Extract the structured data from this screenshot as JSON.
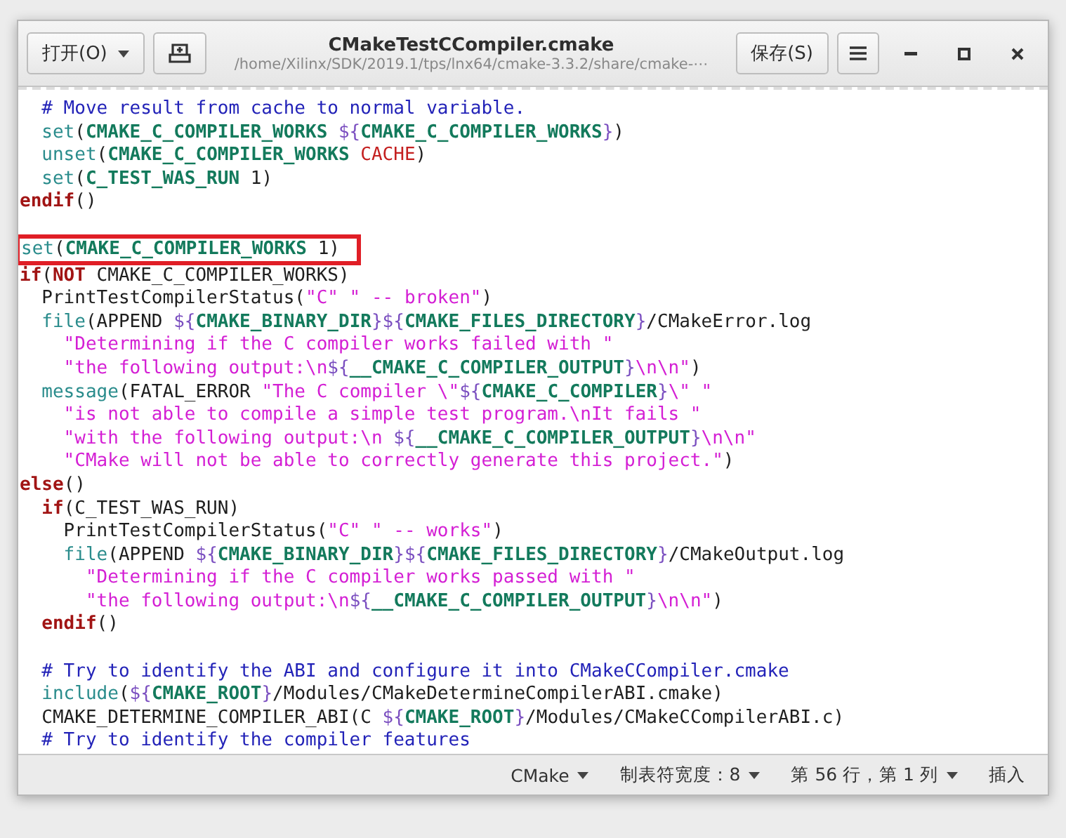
{
  "window": {
    "title": "CMakeTestCCompiler.cmake",
    "subtitle": "/home/Xilinx/SDK/2019.1/tps/lnx64/cmake-3.3.2/share/cmake-⋯"
  },
  "header": {
    "open_button": "打开(O)",
    "save_button": "保存(S)"
  },
  "editor": {
    "lines": [
      {
        "kind": "code",
        "segments": [
          {
            "kind": "comment",
            "text": "  # Move result from cache to normal variable."
          }
        ]
      },
      {
        "kind": "code",
        "segments": [
          {
            "kind": "command",
            "text": "  set"
          },
          {
            "kind": "plain",
            "text": "("
          },
          {
            "kind": "variable",
            "text": "CMAKE_C_COMPILER_WORKS"
          },
          {
            "kind": "brace",
            "text": " ${"
          },
          {
            "kind": "variable",
            "text": "CMAKE_C_COMPILER_WORKS"
          },
          {
            "kind": "brace",
            "text": "}"
          },
          {
            "kind": "plain",
            "text": ")"
          }
        ]
      },
      {
        "kind": "code",
        "segments": [
          {
            "kind": "command",
            "text": "  unset"
          },
          {
            "kind": "plain",
            "text": "("
          },
          {
            "kind": "variable",
            "text": "CMAKE_C_COMPILER_WORKS"
          },
          {
            "kind": "constant",
            "text": " CACHE"
          },
          {
            "kind": "plain",
            "text": ")"
          }
        ]
      },
      {
        "kind": "code",
        "segments": [
          {
            "kind": "command",
            "text": "  set"
          },
          {
            "kind": "plain",
            "text": "("
          },
          {
            "kind": "variable",
            "text": "C_TEST_WAS_RUN"
          },
          {
            "kind": "plain",
            "text": " 1)"
          }
        ]
      },
      {
        "kind": "code",
        "segments": [
          {
            "kind": "control",
            "text": "endif"
          },
          {
            "kind": "plain",
            "text": "()"
          }
        ]
      },
      {
        "kind": "blank"
      },
      {
        "kind": "code",
        "boxed": true,
        "segments": [
          {
            "kind": "command",
            "text": "set"
          },
          {
            "kind": "plain",
            "text": "("
          },
          {
            "kind": "variable",
            "text": "CMAKE_C_COMPILER_WORKS"
          },
          {
            "kind": "plain",
            "text": " 1)"
          }
        ]
      },
      {
        "kind": "code",
        "segments": [
          {
            "kind": "control",
            "text": "if"
          },
          {
            "kind": "plain",
            "text": "("
          },
          {
            "kind": "control",
            "text": "NOT"
          },
          {
            "kind": "plain",
            "text": " CMAKE_C_COMPILER_WORKS)"
          }
        ]
      },
      {
        "kind": "code",
        "segments": [
          {
            "kind": "plain",
            "text": "  PrintTestCompilerStatus("
          },
          {
            "kind": "string",
            "text": "\"C\" \" -- broken\""
          },
          {
            "kind": "plain",
            "text": ")"
          }
        ]
      },
      {
        "kind": "code",
        "segments": [
          {
            "kind": "command",
            "text": "  file"
          },
          {
            "kind": "plain",
            "text": "(APPEND "
          },
          {
            "kind": "brace",
            "text": "${"
          },
          {
            "kind": "variable",
            "text": "CMAKE_BINARY_DIR"
          },
          {
            "kind": "brace",
            "text": "}${"
          },
          {
            "kind": "variable",
            "text": "CMAKE_FILES_DIRECTORY"
          },
          {
            "kind": "brace",
            "text": "}"
          },
          {
            "kind": "plain",
            "text": "/CMakeError.log"
          }
        ]
      },
      {
        "kind": "code",
        "segments": [
          {
            "kind": "string",
            "text": "    \"Determining if the C compiler works failed with \""
          }
        ]
      },
      {
        "kind": "code",
        "segments": [
          {
            "kind": "string",
            "text": "    \"the following output:\\n"
          },
          {
            "kind": "brace",
            "text": "${"
          },
          {
            "kind": "variable",
            "text": "__CMAKE_C_COMPILER_OUTPUT"
          },
          {
            "kind": "brace",
            "text": "}"
          },
          {
            "kind": "string",
            "text": "\\n\\n\""
          },
          {
            "kind": "plain",
            "text": ")"
          }
        ]
      },
      {
        "kind": "code",
        "segments": [
          {
            "kind": "command",
            "text": "  message"
          },
          {
            "kind": "plain",
            "text": "(FATAL_ERROR "
          },
          {
            "kind": "string",
            "text": "\"The C compiler \\\""
          },
          {
            "kind": "brace",
            "text": "${"
          },
          {
            "kind": "variable",
            "text": "CMAKE_C_COMPILER"
          },
          {
            "kind": "brace",
            "text": "}"
          },
          {
            "kind": "string",
            "text": "\\\" \""
          }
        ]
      },
      {
        "kind": "code",
        "segments": [
          {
            "kind": "string",
            "text": "    \"is not able to compile a simple test program.\\nIt fails \""
          }
        ]
      },
      {
        "kind": "code",
        "segments": [
          {
            "kind": "string",
            "text": "    \"with the following output:\\n "
          },
          {
            "kind": "brace",
            "text": "${"
          },
          {
            "kind": "variable",
            "text": "__CMAKE_C_COMPILER_OUTPUT"
          },
          {
            "kind": "brace",
            "text": "}"
          },
          {
            "kind": "string",
            "text": "\\n\\n\""
          }
        ]
      },
      {
        "kind": "code",
        "segments": [
          {
            "kind": "string",
            "text": "    \"CMake will not be able to correctly generate this project.\""
          },
          {
            "kind": "plain",
            "text": ")"
          }
        ]
      },
      {
        "kind": "code",
        "segments": [
          {
            "kind": "control",
            "text": "else"
          },
          {
            "kind": "plain",
            "text": "()"
          }
        ]
      },
      {
        "kind": "code",
        "segments": [
          {
            "kind": "control",
            "text": "  if"
          },
          {
            "kind": "plain",
            "text": "(C_TEST_WAS_RUN)"
          }
        ]
      },
      {
        "kind": "code",
        "segments": [
          {
            "kind": "plain",
            "text": "    PrintTestCompilerStatus("
          },
          {
            "kind": "string",
            "text": "\"C\" \" -- works\""
          },
          {
            "kind": "plain",
            "text": ")"
          }
        ]
      },
      {
        "kind": "code",
        "segments": [
          {
            "kind": "command",
            "text": "    file"
          },
          {
            "kind": "plain",
            "text": "(APPEND "
          },
          {
            "kind": "brace",
            "text": "${"
          },
          {
            "kind": "variable",
            "text": "CMAKE_BINARY_DIR"
          },
          {
            "kind": "brace",
            "text": "}${"
          },
          {
            "kind": "variable",
            "text": "CMAKE_FILES_DIRECTORY"
          },
          {
            "kind": "brace",
            "text": "}"
          },
          {
            "kind": "plain",
            "text": "/CMakeOutput.log"
          }
        ]
      },
      {
        "kind": "code",
        "segments": [
          {
            "kind": "string",
            "text": "      \"Determining if the C compiler works passed with \""
          }
        ]
      },
      {
        "kind": "code",
        "segments": [
          {
            "kind": "string",
            "text": "      \"the following output:\\n"
          },
          {
            "kind": "brace",
            "text": "${"
          },
          {
            "kind": "variable",
            "text": "__CMAKE_C_COMPILER_OUTPUT"
          },
          {
            "kind": "brace",
            "text": "}"
          },
          {
            "kind": "string",
            "text": "\\n\\n\""
          },
          {
            "kind": "plain",
            "text": ")"
          }
        ]
      },
      {
        "kind": "code",
        "segments": [
          {
            "kind": "control",
            "text": "  endif"
          },
          {
            "kind": "plain",
            "text": "()"
          }
        ]
      },
      {
        "kind": "blank"
      },
      {
        "kind": "code",
        "segments": [
          {
            "kind": "comment",
            "text": "  # Try to identify the ABI and configure it into CMakeCCompiler.cmake"
          }
        ]
      },
      {
        "kind": "code",
        "segments": [
          {
            "kind": "command",
            "text": "  include"
          },
          {
            "kind": "plain",
            "text": "("
          },
          {
            "kind": "brace",
            "text": "${"
          },
          {
            "kind": "variable",
            "text": "CMAKE_ROOT"
          },
          {
            "kind": "brace",
            "text": "}"
          },
          {
            "kind": "plain",
            "text": "/Modules/CMakeDetermineCompilerABI.cmake)"
          }
        ]
      },
      {
        "kind": "code",
        "segments": [
          {
            "kind": "plain",
            "text": "  CMAKE_DETERMINE_COMPILER_ABI(C "
          },
          {
            "kind": "brace",
            "text": "${"
          },
          {
            "kind": "variable",
            "text": "CMAKE_ROOT"
          },
          {
            "kind": "brace",
            "text": "}"
          },
          {
            "kind": "plain",
            "text": "/Modules/CMakeCCompilerABI.c)"
          }
        ]
      },
      {
        "kind": "code",
        "segments": [
          {
            "kind": "comment",
            "text": "  # Try to identify the compiler features"
          }
        ]
      }
    ]
  },
  "status_bar": {
    "language": "CMake",
    "tab_width": "制表符宽度：8",
    "position": "第 56 行，第 1 列",
    "mode": "插入"
  }
}
